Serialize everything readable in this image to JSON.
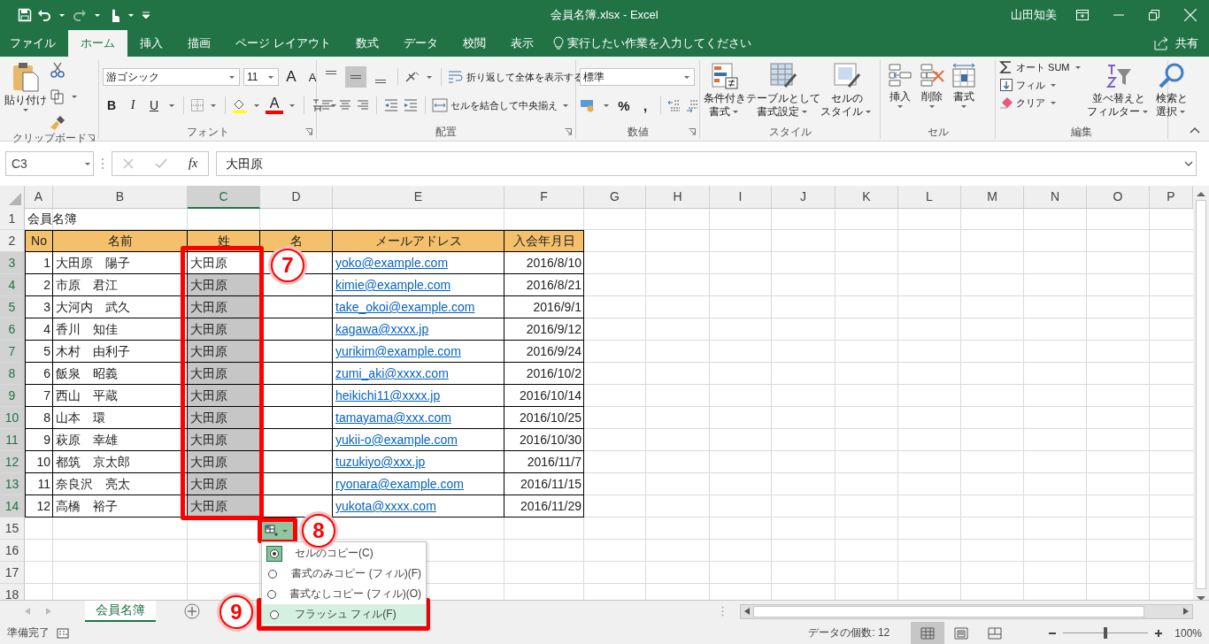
{
  "window": {
    "title": "会員名簿.xlsx - Excel",
    "user": "山田知美"
  },
  "menu_tabs": [
    {
      "label": "ファイル",
      "selected": false
    },
    {
      "label": "ホーム",
      "selected": true
    },
    {
      "label": "挿入",
      "selected": false
    },
    {
      "label": "描画",
      "selected": false
    },
    {
      "label": "ページ レイアウト",
      "selected": false
    },
    {
      "label": "数式",
      "selected": false
    },
    {
      "label": "データ",
      "selected": false
    },
    {
      "label": "校閲",
      "selected": false
    },
    {
      "label": "表示",
      "selected": false
    }
  ],
  "tell_me": "実行したい作業を入力してください",
  "share": "共有",
  "ribbon": [
    {
      "kind": "clipboard",
      "label": "クリップボード",
      "paste": "貼り付け"
    },
    {
      "kind": "font",
      "label": "フォント",
      "font": "游ゴシック",
      "size": "11",
      "grow": "A",
      "shrink": "A",
      "bold": "B",
      "italic": "I",
      "underline": "U",
      "font_color": "A"
    },
    {
      "kind": "alignment",
      "label": "配置",
      "vertical_align": [
        {
          "selected": false
        },
        {
          "selected": true
        },
        {
          "selected": false
        }
      ],
      "wrap": "折り返して全体を表示する",
      "merge": "セルを結合して中央揃え"
    },
    {
      "kind": "number",
      "label": "数値",
      "format": "標準",
      "percent": "%",
      "comma": ","
    },
    {
      "kind": "styles",
      "label": "スタイル",
      "buttons": [
        [
          "条件付き",
          "書式"
        ],
        [
          "テーブルとして",
          "書式設定"
        ],
        [
          "セルの",
          "スタイル"
        ]
      ]
    },
    {
      "kind": "cells",
      "label": "セル",
      "buttons": [
        "挿入",
        "削除",
        "書式"
      ]
    },
    {
      "kind": "editing",
      "label": "編集",
      "autosum": "オート SUM",
      "fill": "フィル",
      "clear": "クリア",
      "sort": [
        "並べ替えと",
        "フィルター"
      ],
      "find": [
        "検索と",
        "選択"
      ]
    }
  ],
  "formula_bar": {
    "name_box": "C3",
    "fx": "fx",
    "formula": "大田原"
  },
  "sheet": {
    "columns": [
      {
        "label": "A",
        "selected": false
      },
      {
        "label": "B",
        "selected": false
      },
      {
        "label": "C",
        "selected": true
      },
      {
        "label": "D",
        "selected": false
      },
      {
        "label": "E",
        "selected": false
      },
      {
        "label": "F",
        "selected": false
      },
      {
        "label": "G",
        "selected": false
      },
      {
        "label": "H",
        "selected": false
      },
      {
        "label": "I",
        "selected": false
      },
      {
        "label": "J",
        "selected": false
      },
      {
        "label": "K",
        "selected": false
      },
      {
        "label": "L",
        "selected": false
      },
      {
        "label": "M",
        "selected": false
      },
      {
        "label": "N",
        "selected": false
      },
      {
        "label": "O",
        "selected": false
      },
      {
        "label": "P",
        "selected": false
      }
    ],
    "title_row": {
      "row": "1",
      "text": "会員名簿"
    },
    "header_row": {
      "row": "2",
      "cells": [
        "No",
        "名前",
        "姓",
        "名",
        "メールアドレス",
        "入会年月日"
      ]
    },
    "records": [
      {
        "row": "3",
        "selected": true,
        "active": true,
        "no": "1",
        "name": "大田原　陽子",
        "last": "大田原",
        "email": "yoko@example.com",
        "joined": "2016/8/10"
      },
      {
        "row": "4",
        "selected": true,
        "active": false,
        "no": "2",
        "name": "市原　君江",
        "last": "大田原",
        "email": "kimie@example.com",
        "joined": "2016/8/21"
      },
      {
        "row": "5",
        "selected": true,
        "active": false,
        "no": "3",
        "name": "大河内　武久",
        "last": "大田原",
        "email": "take_okoi@example.com",
        "joined": "2016/9/1"
      },
      {
        "row": "6",
        "selected": true,
        "active": false,
        "no": "4",
        "name": "香川　知佳",
        "last": "大田原",
        "email": "kagawa@xxxx.jp",
        "joined": "2016/9/12"
      },
      {
        "row": "7",
        "selected": true,
        "active": false,
        "no": "5",
        "name": "木村　由利子",
        "last": "大田原",
        "email": "yurikim@example.com",
        "joined": "2016/9/24"
      },
      {
        "row": "8",
        "selected": true,
        "active": false,
        "no": "6",
        "name": "飯泉　昭義",
        "last": "大田原",
        "email": "zumi_aki@xxxx.com",
        "joined": "2016/10/2"
      },
      {
        "row": "9",
        "selected": true,
        "active": false,
        "no": "7",
        "name": "西山　平蔵",
        "last": "大田原",
        "email": "heikichi11@xxxx.jp",
        "joined": "2016/10/14"
      },
      {
        "row": "10",
        "selected": true,
        "active": false,
        "no": "8",
        "name": "山本　環",
        "last": "大田原",
        "email": "tamayama@xxx.com",
        "joined": "2016/10/25"
      },
      {
        "row": "11",
        "selected": true,
        "active": false,
        "no": "9",
        "name": "萩原　幸雄",
        "last": "大田原",
        "email": "yukii-o@example.com",
        "joined": "2016/10/30"
      },
      {
        "row": "12",
        "selected": true,
        "active": false,
        "no": "10",
        "name": "都筑　京太郎",
        "last": "大田原",
        "email": "tuzukiyo@xxx.jp",
        "joined": "2016/11/7"
      },
      {
        "row": "13",
        "selected": true,
        "active": false,
        "no": "11",
        "name": "奈良沢　亮太",
        "last": "大田原",
        "email": "ryonara@example.com",
        "joined": "2016/11/15"
      },
      {
        "row": "14",
        "selected": true,
        "active": false,
        "no": "12",
        "name": "高橋　裕子",
        "last": "大田原",
        "email": "yukota@xxxx.com",
        "joined": "2016/11/29"
      }
    ],
    "empty_rows": [
      "15",
      "16",
      "17",
      "18"
    ]
  },
  "fill_menu": [
    {
      "label": "セルのコピー(C)",
      "checked": true,
      "highlighted": false
    },
    {
      "label": "書式のみコピー (フィル)(F)",
      "checked": false,
      "highlighted": false
    },
    {
      "label": "書式なしコピー (フィル)(O)",
      "checked": false,
      "highlighted": false
    },
    {
      "label": "フラッシュ フィル(F)",
      "checked": false,
      "highlighted": true
    }
  ],
  "callouts": [
    "7",
    "8",
    "9"
  ],
  "sheet_tabs": [
    {
      "label": "会員名簿",
      "selected": true
    }
  ],
  "status_bar": {
    "ready": "準備完了",
    "count": "データの個数: 12",
    "views": [
      {
        "selected": true
      },
      {
        "selected": false
      },
      {
        "selected": false
      }
    ],
    "zoom": {
      "level": 0.5,
      "reading": "100%"
    }
  }
}
